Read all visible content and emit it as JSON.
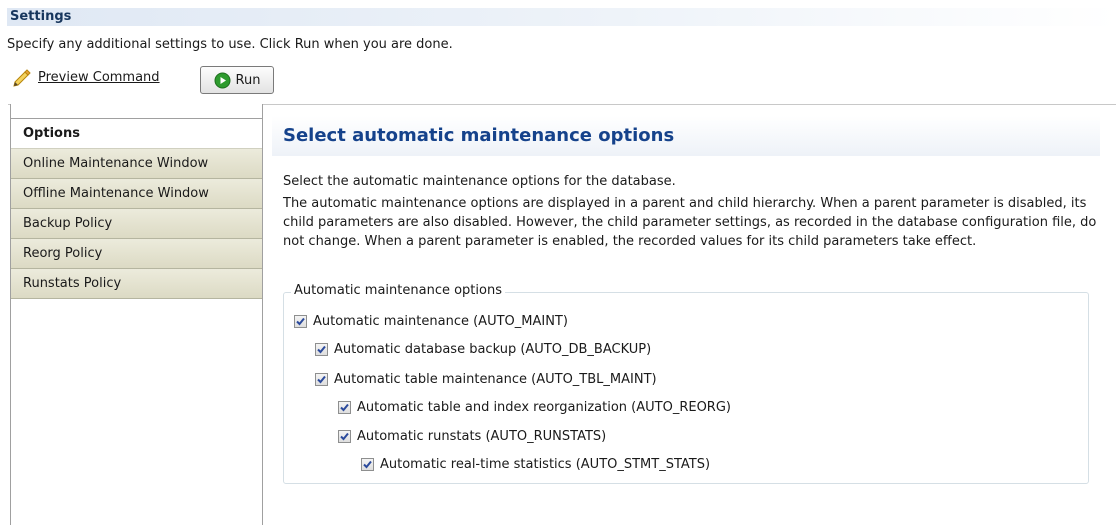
{
  "header": {
    "title": "Settings",
    "description": "Specify any additional settings to use. Click Run when you are done.",
    "preview_command_label": "Preview Command",
    "run_label": "Run"
  },
  "sidebar": {
    "items": [
      {
        "label": "Options",
        "active": true
      },
      {
        "label": "Online Maintenance Window",
        "active": false
      },
      {
        "label": "Offline Maintenance Window",
        "active": false
      },
      {
        "label": "Backup Policy",
        "active": false
      },
      {
        "label": "Reorg Policy",
        "active": false
      },
      {
        "label": "Runstats Policy",
        "active": false
      }
    ]
  },
  "main": {
    "title": "Select automatic maintenance options",
    "intro": "Select the automatic maintenance options for the database.",
    "details": "The automatic maintenance options are displayed in a parent and child hierarchy. When a parent parameter is disabled, its child parameters are also disabled. However, the child parameter settings, as recorded in the database configuration file, do not change. When a parent parameter is enabled, the recorded values for its child parameters take effect.",
    "group": {
      "legend": "Automatic maintenance options",
      "options": [
        {
          "label": "Automatic maintenance (AUTO_MAINT)",
          "checked": true,
          "level": 0
        },
        {
          "label": "Automatic database backup (AUTO_DB_BACKUP)",
          "checked": true,
          "level": 1
        },
        {
          "label": "Automatic table maintenance (AUTO_TBL_MAINT)",
          "checked": true,
          "level": 1
        },
        {
          "label": "Automatic table and index reorganization (AUTO_REORG)",
          "checked": true,
          "level": 2
        },
        {
          "label": "Automatic runstats (AUTO_RUNSTATS)",
          "checked": true,
          "level": 2
        },
        {
          "label": "Automatic real-time statistics (AUTO_STMT_STATS)",
          "checked": true,
          "level": 3
        }
      ]
    }
  },
  "colors": {
    "title_blue": "#15428b",
    "settings_blue": "#17365d",
    "check_blue": "#2b4a9c",
    "run_green": "#2e9b2e"
  },
  "icons": {
    "preview": "pencil-icon",
    "run": "run-icon",
    "checkbox": "checkbox-checked-icon"
  }
}
